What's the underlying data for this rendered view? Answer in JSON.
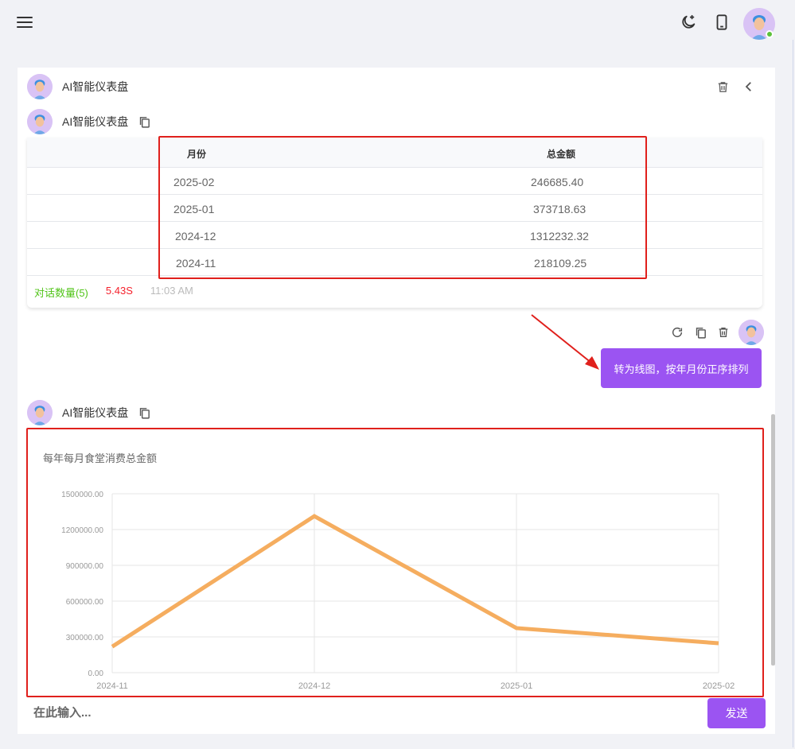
{
  "header": {
    "menu_icon": "menu-icon",
    "theme_icon": "moon-star-icon",
    "device_icon": "phone-icon",
    "avatar_icon": "user-avatar"
  },
  "session": {
    "title": "AI智能仪表盘",
    "delete_icon": "trash-icon",
    "back_icon": "chevron-left-icon"
  },
  "messages": [
    {
      "sender": "AI智能仪表盘",
      "copy_icon": "copy-icon",
      "table": {
        "columns": [
          "月份",
          "总金额"
        ],
        "rows": [
          [
            "2025-02",
            "246685.40"
          ],
          [
            "2025-01",
            "373718.63"
          ],
          [
            "2024-12",
            "1312232.32"
          ],
          [
            "2024-11",
            "218109.25"
          ]
        ]
      },
      "meta": {
        "count": "对话数量(5)",
        "duration": "5.43S",
        "time": "11:03 AM"
      }
    },
    {
      "role": "user",
      "text": "转为线图，按年月份正序排列",
      "icons": [
        "refresh-icon",
        "copy-icon",
        "trash-icon"
      ]
    },
    {
      "sender": "AI智能仪表盘",
      "copy_icon": "copy-icon"
    }
  ],
  "chart_data": {
    "type": "line",
    "title": "每年每月食堂消费总金额",
    "x": [
      "2024-11",
      "2024-12",
      "2025-01",
      "2025-02"
    ],
    "series": [
      {
        "values": [
          218109.25,
          1312232.32,
          373718.63,
          246685.4
        ],
        "color": "#f5ad5f"
      }
    ],
    "y_ticks": [
      "0.00",
      "300000.00",
      "600000.00",
      "900000.00",
      "1200000.00",
      "1500000.00"
    ],
    "ylim": [
      0,
      1500000
    ],
    "grid": true
  },
  "composer": {
    "placeholder": "在此输入...",
    "send_label": "发送"
  },
  "colors": {
    "accent": "#9b54f2",
    "annotation": "#e0201c",
    "count": "#52c41a",
    "duration": "#f5222d",
    "line": "#f5ad5f"
  }
}
